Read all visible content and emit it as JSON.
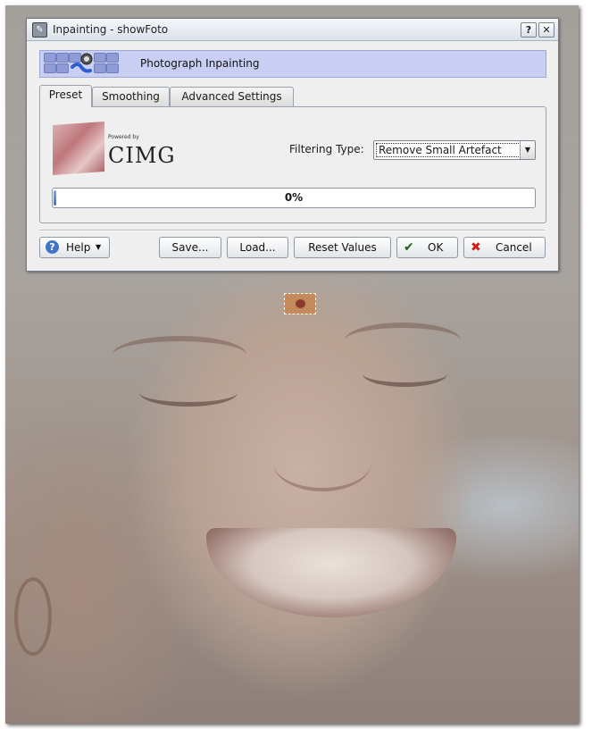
{
  "window": {
    "title": "Inpainting - showFoto",
    "help_glyph": "?",
    "close_glyph": "✕"
  },
  "header": {
    "title": "Photograph Inpainting"
  },
  "tabs": [
    {
      "label": "Preset",
      "active": true
    },
    {
      "label": "Smoothing",
      "active": false
    },
    {
      "label": "Advanced Settings",
      "active": false
    }
  ],
  "preset": {
    "powered_by": "Powered by",
    "logo_text": "CIMG",
    "filter_label": "Filtering Type:",
    "filter_value": "Remove Small Artefact",
    "progress_text": "0%",
    "progress_value": 0
  },
  "buttons": {
    "help": "Help",
    "save": "Save...",
    "load": "Load...",
    "reset": "Reset Values",
    "ok": "OK",
    "cancel": "Cancel"
  },
  "icons": {
    "app": "showfoto-icon",
    "help": "help-icon",
    "ok": "checkmark-icon",
    "cancel": "x-icon",
    "dropdown": "chevron-down-icon"
  },
  "colors": {
    "banner": "#c8cff2",
    "ok_check": "#1b5f1b",
    "cancel_x": "#d12020",
    "help_blue": "#3f74c9"
  }
}
